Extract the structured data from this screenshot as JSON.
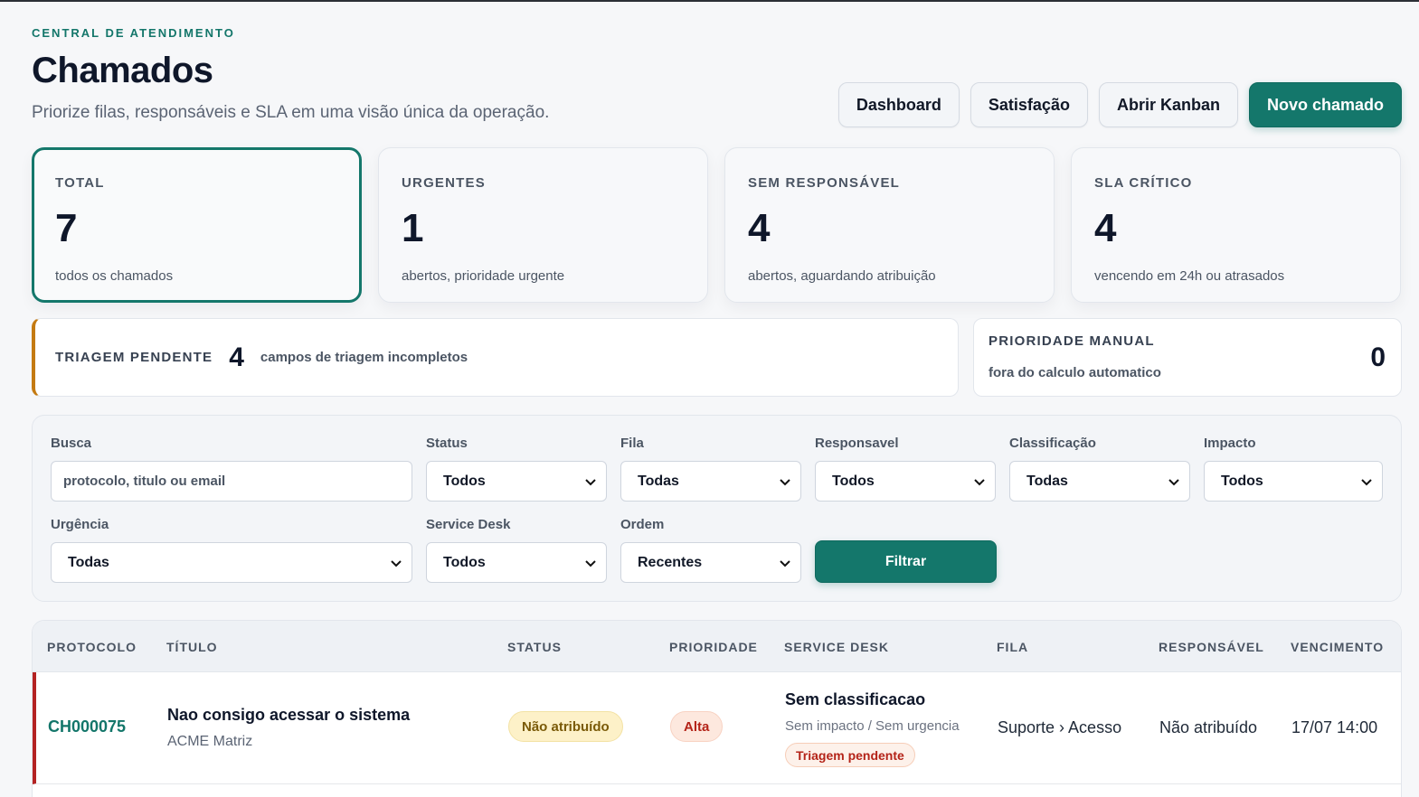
{
  "header": {
    "eyebrow": "CENTRAL DE ATENDIMENTO",
    "title": "Chamados",
    "subtitle": "Priorize filas, responsáveis e SLA em uma visão única da operação.",
    "actions": {
      "dashboard": "Dashboard",
      "satisfaction": "Satisfação",
      "kanban": "Abrir Kanban",
      "new_ticket": "Novo chamado"
    }
  },
  "stats": [
    {
      "label": "TOTAL",
      "value": "7",
      "desc": "todos os chamados"
    },
    {
      "label": "URGENTES",
      "value": "1",
      "desc": "abertos, prioridade urgente"
    },
    {
      "label": "SEM RESPONSÁVEL",
      "value": "4",
      "desc": "abertos, aguardando atribuição"
    },
    {
      "label": "SLA CRÍTICO",
      "value": "4",
      "desc": "vencendo em 24h ou atrasados"
    }
  ],
  "triage": {
    "label": "TRIAGEM PENDENTE",
    "count": "4",
    "desc": "campos de triagem incompletos"
  },
  "manual": {
    "label": "PRIORIDADE MANUAL",
    "desc": "fora do calculo automatico",
    "count": "0"
  },
  "filters": {
    "search": {
      "label": "Busca",
      "placeholder": "protocolo, titulo ou email"
    },
    "status": {
      "label": "Status",
      "value": "Todos"
    },
    "queue": {
      "label": "Fila",
      "value": "Todas"
    },
    "assignee": {
      "label": "Responsavel",
      "value": "Todos"
    },
    "classification": {
      "label": "Classificação",
      "value": "Todas"
    },
    "impact": {
      "label": "Impacto",
      "value": "Todos"
    },
    "urgency": {
      "label": "Urgência",
      "value": "Todas"
    },
    "service_desk": {
      "label": "Service Desk",
      "value": "Todos"
    },
    "order": {
      "label": "Ordem",
      "value": "Recentes"
    },
    "submit": "Filtrar"
  },
  "table": {
    "columns": [
      "PROTOCOLO",
      "TÍTULO",
      "STATUS",
      "PRIORIDADE",
      "SERVICE DESK",
      "FILA",
      "RESPONSÁVEL",
      "VENCIMENTO"
    ],
    "rows": [
      {
        "protocol": "CH000075",
        "title": "Nao consigo acessar o sistema",
        "client": "ACME Matriz",
        "status": "Não atribuído",
        "priority": "Alta",
        "service_desk_title": "Sem classificacao",
        "service_desk_sub": "Sem impacto / Sem urgencia",
        "triage_badge": "Triagem pendente",
        "queue": "Suporte › Acesso",
        "assignee": "Não atribuído",
        "due": "17/07 14:00"
      }
    ]
  },
  "colors": {
    "brand": "#14776b",
    "priority_high_border": "#b42323",
    "triage_accent": "#c47a12"
  }
}
